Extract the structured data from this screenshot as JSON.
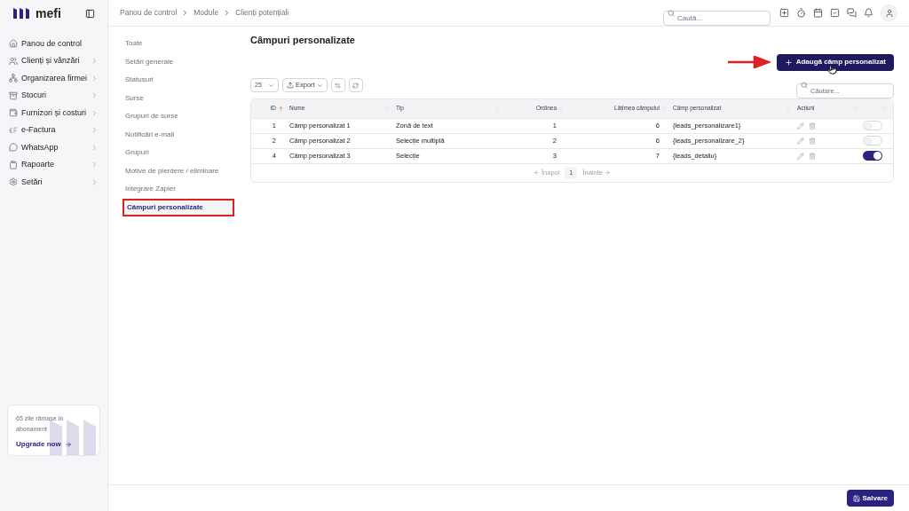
{
  "brand": {
    "name": "mefi"
  },
  "sidebar": {
    "items": [
      {
        "label": "Panou de control",
        "kind": "link"
      },
      {
        "label": "Clienți și vânzări",
        "kind": "group"
      },
      {
        "label": "Organizarea firmei",
        "kind": "group"
      },
      {
        "label": "Stocuri",
        "kind": "group"
      },
      {
        "label": "Furnizori și costuri",
        "kind": "group"
      },
      {
        "label": "e-Factura",
        "kind": "group"
      },
      {
        "label": "WhatsApp",
        "kind": "group"
      },
      {
        "label": "Rapoarte",
        "kind": "group"
      },
      {
        "label": "Setări",
        "kind": "group"
      }
    ],
    "promo": {
      "text": "65 zile rămase în abonament",
      "link": "Upgrade now"
    }
  },
  "breadcrumb": [
    "Panou de control",
    "Module",
    "Clienți potențiali"
  ],
  "search": {
    "placeholder": "Caută..."
  },
  "submenu": [
    {
      "label": "Toate",
      "selected": false
    },
    {
      "label": "Setări generale",
      "selected": false
    },
    {
      "label": "Statusuri",
      "selected": false
    },
    {
      "label": "Surse",
      "selected": false
    },
    {
      "label": "Grupuri de surse",
      "selected": false
    },
    {
      "label": "Notificări e-mail",
      "selected": false
    },
    {
      "label": "Grupuri",
      "selected": false
    },
    {
      "label": "Motive de pierdere / eliminare",
      "selected": false
    },
    {
      "label": "Integrare Zapier",
      "selected": false
    },
    {
      "label": "Câmpuri personalizate",
      "selected": true
    }
  ],
  "page": {
    "title": "Câmpuri personalizate",
    "add_button": "Adaugă câmp personalizat"
  },
  "toolbar": {
    "page_size": "25",
    "export": "Export",
    "search_placeholder": "Căutare..."
  },
  "table": {
    "columns": [
      {
        "label": "ID",
        "sorted": true
      },
      {
        "label": "Nume",
        "sorted": false
      },
      {
        "label": "Tip",
        "sorted": false
      },
      {
        "label": "Ordinea",
        "sorted": false
      },
      {
        "label": "Lățimea câmpului",
        "sorted": false
      },
      {
        "label": "Câmp personalizat",
        "sorted": false
      },
      {
        "label": "Acțiuni",
        "sorted": false
      }
    ],
    "rows": [
      {
        "cells": [
          "1",
          "Câmp personalizat 1",
          "Zonă de text",
          "1",
          "6",
          "{leads_personalizare1}"
        ],
        "on": false
      },
      {
        "cells": [
          "2",
          "Câmp personalizat 2",
          "Selecție multiplă",
          "2",
          "6",
          "{leads_personalizare_2}"
        ],
        "on": false
      },
      {
        "cells": [
          "4",
          "Câmp personalizat 3",
          "Selecție",
          "3",
          "7",
          "{leads_detaliu}"
        ],
        "on": true
      }
    ]
  },
  "pagination": {
    "prev": "Înapoi",
    "current": "1",
    "next": "Înainte"
  },
  "save_button": "Salvare"
}
